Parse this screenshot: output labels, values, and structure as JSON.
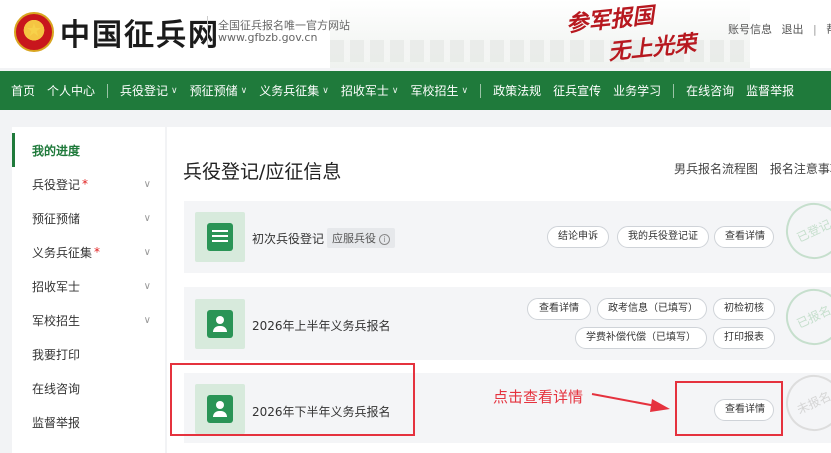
{
  "header": {
    "site_name": "中国征兵网",
    "subtitle_line1": "全国征兵报名唯一官方网站",
    "subtitle_line2": "www.gfbzb.gov.cn",
    "slogan_line1": "参军报国",
    "slogan_line2": "无上光荣",
    "links": [
      "账号信息",
      "退出",
      "帮助"
    ]
  },
  "nav": {
    "items": [
      {
        "label": "首页",
        "dropdown": false
      },
      {
        "label": "个人中心",
        "dropdown": false
      },
      {
        "label": "兵役登记",
        "dropdown": true
      },
      {
        "label": "预征预储",
        "dropdown": true
      },
      {
        "label": "义务兵征集",
        "dropdown": true
      },
      {
        "label": "招收军士",
        "dropdown": true
      },
      {
        "label": "军校招生",
        "dropdown": true
      },
      {
        "label": "政策法规",
        "dropdown": false
      },
      {
        "label": "征兵宣传",
        "dropdown": false
      },
      {
        "label": "业务学习",
        "dropdown": false
      },
      {
        "label": "在线咨询",
        "dropdown": false
      },
      {
        "label": "监督举报",
        "dropdown": false
      }
    ]
  },
  "sidebar": {
    "items": [
      {
        "label": "我的进度",
        "active": true
      },
      {
        "label": "兵役登记",
        "required": "*",
        "chevron": true
      },
      {
        "label": "预征预储",
        "chevron": true
      },
      {
        "label": "义务兵征集",
        "required": "*",
        "chevron": true
      },
      {
        "label": "招收军士",
        "chevron": true
      },
      {
        "label": "军校招生",
        "chevron": true
      },
      {
        "label": "我要打印"
      },
      {
        "label": "在线咨询"
      },
      {
        "label": "监督举报"
      }
    ]
  },
  "main": {
    "title": "兵役登记/应征信息",
    "links": [
      "男兵报名流程图",
      "报名注意事项"
    ]
  },
  "cards": {
    "registration": {
      "title": "初次兵役登记",
      "tag": "应服兵役",
      "buttons": [
        "结论申诉",
        "我的兵役登记证",
        "查看详情"
      ],
      "stamp": "已登记"
    },
    "first_half": {
      "title": "2026年上半年义务兵报名",
      "buttons": [
        "查看详情",
        "政考信息（已填写）",
        "初检初核",
        "学费补偿代偿（已填写）",
        "打印报表"
      ],
      "stamp": "已报名"
    },
    "second_half": {
      "title": "2026年下半年义务兵报名",
      "buttons": [
        "查看详情"
      ],
      "stamp": "未报名"
    }
  },
  "annotation": {
    "text": "点击查看详情",
    "color": "#e5323e"
  },
  "colors": {
    "brand_green": "#1f7a3b",
    "annotation_red": "#e5323e"
  }
}
